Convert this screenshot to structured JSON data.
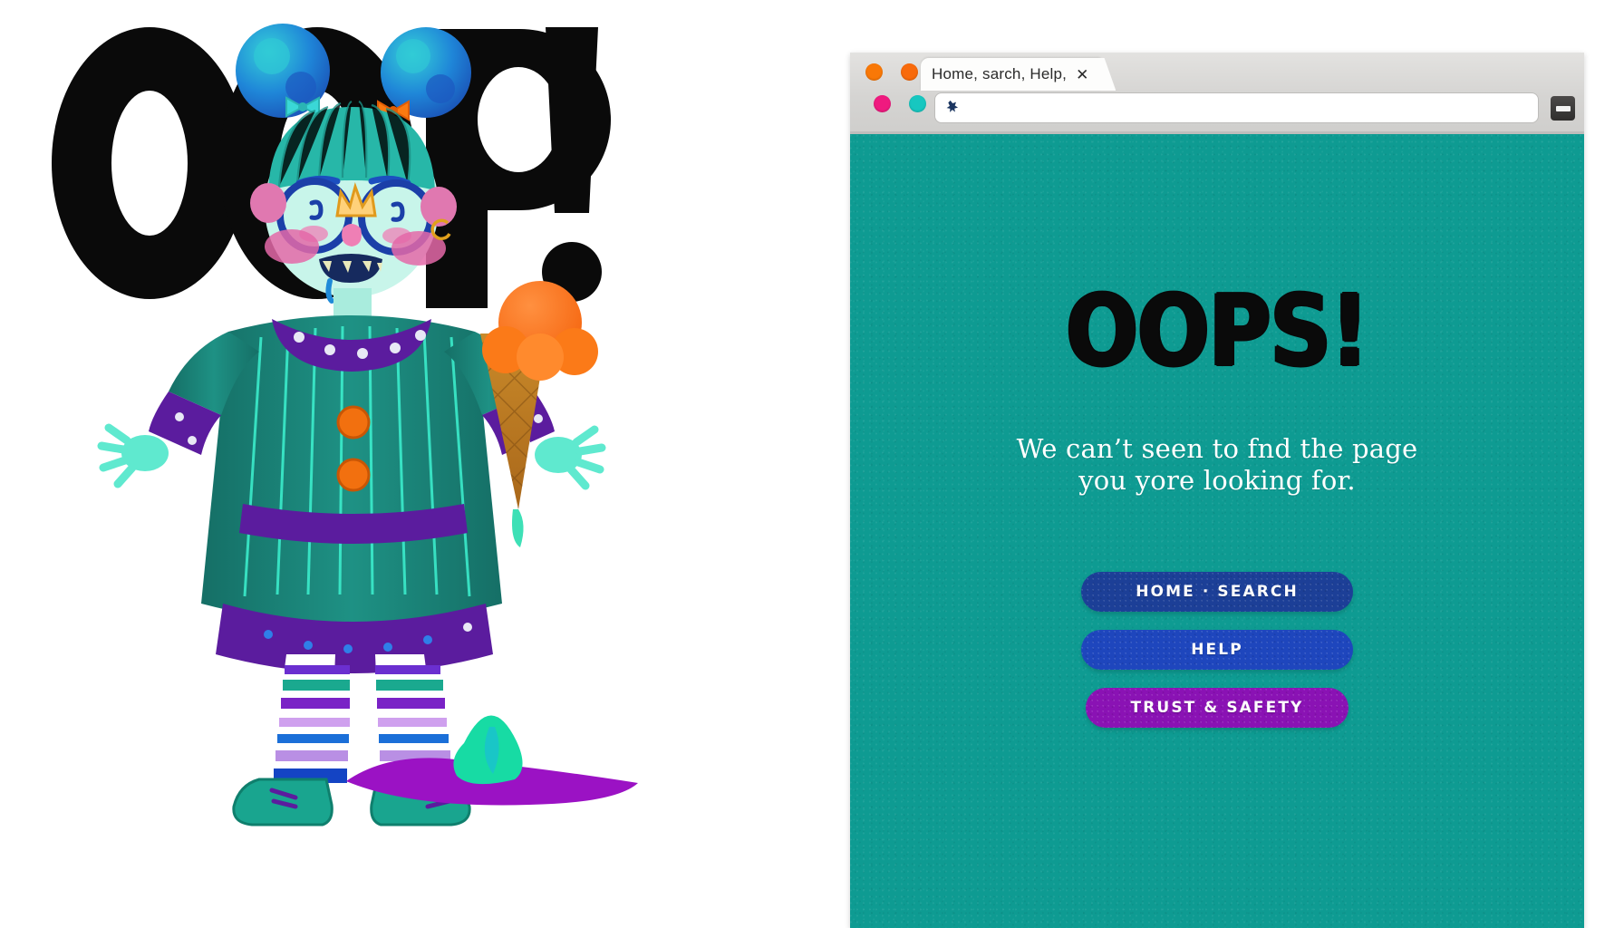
{
  "browser": {
    "tab": {
      "title": "Home, sarch, Help,",
      "close_glyph": "✕"
    },
    "address_bar": {
      "value": "",
      "placeholder": "",
      "icon": "puzzle-piece-icon"
    },
    "minimize_label": "",
    "traffic_lights": {
      "top_row": [
        {
          "name": "window-dot-orange-1",
          "color": "#f97807"
        },
        {
          "name": "window-dot-orange-2",
          "color": "#f86a0b"
        },
        {
          "name": "window-dot-green-1",
          "color": "#24c019"
        }
      ],
      "bottom_row": [
        {
          "name": "window-dot-pink",
          "color": "#ef1a7f"
        },
        {
          "name": "window-dot-cyan",
          "color": "#17c7c0"
        },
        {
          "name": "window-dot-green-2",
          "color": "#15c215"
        }
      ]
    }
  },
  "page": {
    "background_color": "#0e9b92",
    "heading": "OOPS!",
    "message_line1": "We can’t seen to fnd the page",
    "message_line2": "you yore looking for.",
    "buttons": [
      {
        "label": "HOME · SEARCH",
        "color": "#1c3f97"
      },
      {
        "label": "HELP",
        "color": "#1e46bd"
      },
      {
        "label": "TRUST & SAFETY",
        "color": "#8a12b4"
      }
    ]
  },
  "illustration": {
    "background_text": "OOP!",
    "background_text_color": "#0a0a0a",
    "alt": "girl-with-melting-ice-cream-illustration",
    "palette": {
      "skin": "#c8f5ea",
      "hair_bun": "#1f6fd0",
      "hair_bun_light": "#24c3c9",
      "bangs": "#27b7a8",
      "dress": "#1f8a7e",
      "dress_stripe": "#3df2d0",
      "trim_purple": "#5b1c9e",
      "button_orange": "#f2700f",
      "ice_cream": "#fb6f10",
      "cone": "#c07a1d",
      "puddle": "#9b12c4",
      "blob_mint": "#17dba4",
      "shoe": "#19a58f",
      "cheek": "#e469a8",
      "glasses": "#1b3fa8"
    }
  }
}
